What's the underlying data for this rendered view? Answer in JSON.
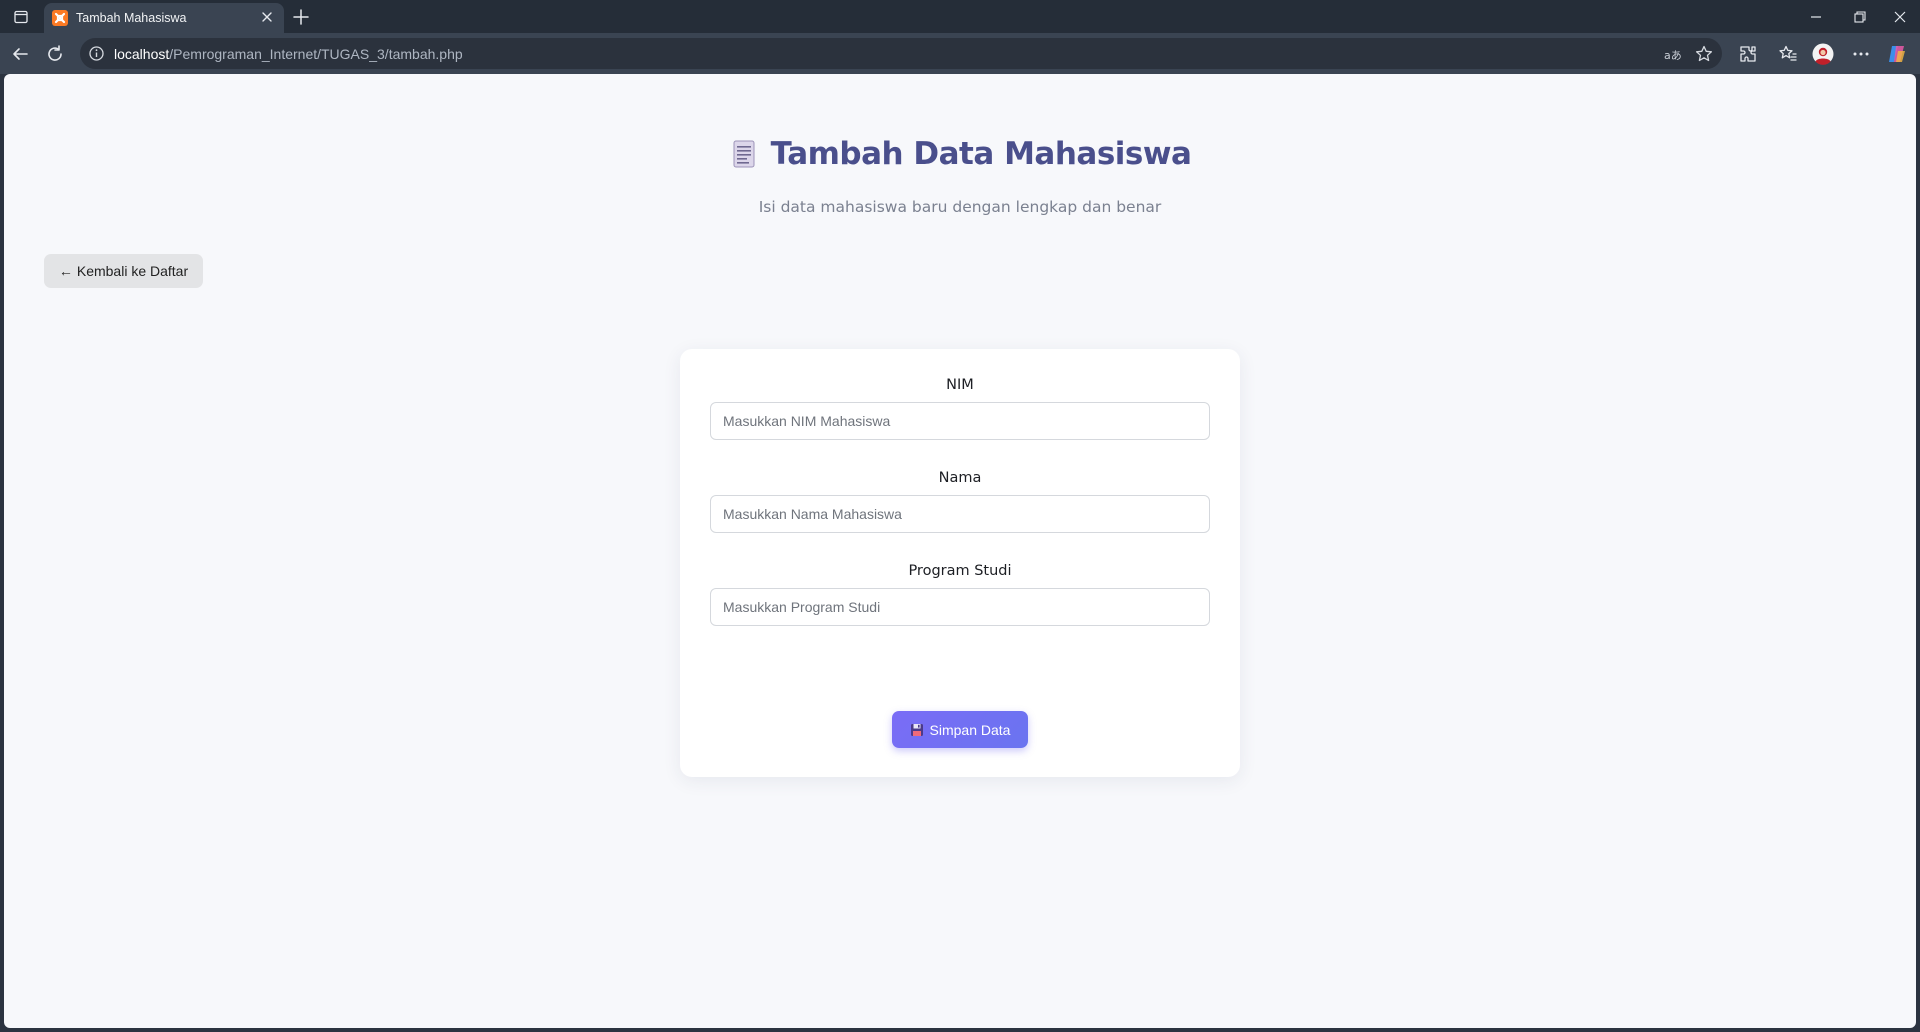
{
  "browser": {
    "tab_title": "Tambah Mahasiswa",
    "url_host": "localhost",
    "url_path": "/Pemrograman_Internet/TUGAS_3/tambah.php"
  },
  "page": {
    "title": "Tambah Data Mahasiswa",
    "subtitle": "Isi data mahasiswa baru dengan lengkap dan benar",
    "back_label": "Kembali ke Daftar",
    "back_arrow": "←"
  },
  "form": {
    "nim": {
      "label": "NIM",
      "placeholder": "Masukkan NIM Mahasiswa",
      "value": ""
    },
    "nama": {
      "label": "Nama",
      "placeholder": "Masukkan Nama Mahasiswa",
      "value": ""
    },
    "prodi": {
      "label": "Program Studi",
      "placeholder": "Masukkan Program Studi",
      "value": ""
    },
    "submit_label": "Simpan Data"
  },
  "icons": {
    "tab_favicon": "xampp-icon",
    "heading": "document-icon",
    "submit": "floppy-disk-icon"
  },
  "colors": {
    "title": "#4a4f8c",
    "accent": "#7a6cf6",
    "page_bg": "#f7f8fb"
  }
}
